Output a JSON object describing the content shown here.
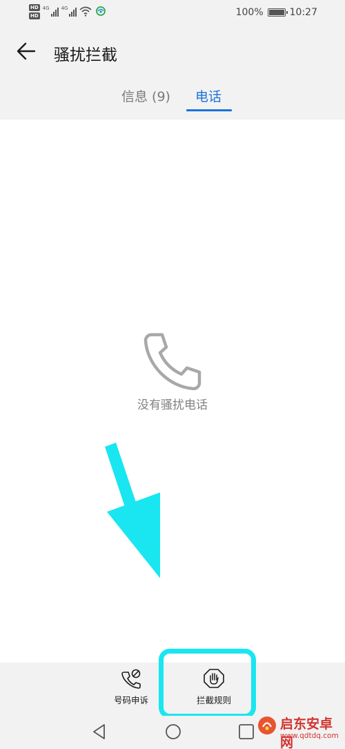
{
  "status_bar": {
    "hd_badge_1": "HD",
    "hd_badge_2": "HD",
    "network_1": "4G",
    "network_2": "4G",
    "battery_percent": "100%",
    "battery_level": 1.0,
    "time": "10:27"
  },
  "header": {
    "title": "骚扰拦截",
    "back_icon": "arrow-left-icon"
  },
  "tabs": [
    {
      "label": "信息 (9)",
      "active": false
    },
    {
      "label": "电话",
      "active": true
    }
  ],
  "colors": {
    "accent": "#1a73d9",
    "annotation": "#19e6f0",
    "background_chrome": "#f2f2f2"
  },
  "empty_state": {
    "icon": "phone-icon",
    "text": "没有骚扰电话"
  },
  "toolbar": {
    "appeal_label": "号码申诉",
    "appeal_icon": "phone-block-icon",
    "rules_label": "拦截规则",
    "rules_icon": "hand-stop-icon"
  },
  "navbar": {
    "back_icon": "triangle-back-icon",
    "home_icon": "circle-home-icon",
    "recent_icon": "square-recent-icon"
  },
  "watermark": {
    "name": "启东安卓网",
    "url": "www.qdtdq.com"
  }
}
